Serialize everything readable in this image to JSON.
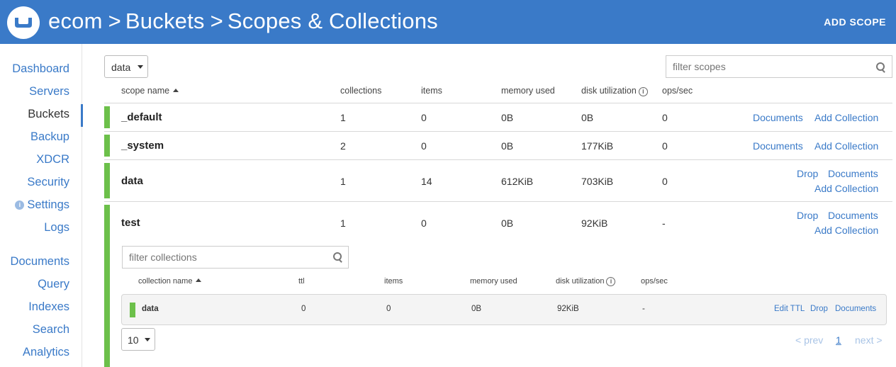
{
  "header": {
    "breadcrumb": [
      "ecom",
      "Buckets",
      "Scopes & Collections"
    ],
    "separator": ">",
    "add_scope_label": "ADD SCOPE"
  },
  "sidebar": {
    "items": [
      {
        "label": "Dashboard"
      },
      {
        "label": "Servers"
      },
      {
        "label": "Buckets",
        "active": true
      },
      {
        "label": "Backup"
      },
      {
        "label": "XDCR"
      },
      {
        "label": "Security"
      },
      {
        "label": "Settings",
        "badge": "i"
      },
      {
        "label": "Logs"
      },
      {
        "label": "Documents"
      },
      {
        "label": "Query"
      },
      {
        "label": "Indexes"
      },
      {
        "label": "Search"
      },
      {
        "label": "Analytics"
      }
    ]
  },
  "bucket_select": {
    "value": "data"
  },
  "filter_scopes": {
    "placeholder": "filter scopes"
  },
  "scope_columns": {
    "name": "scope name",
    "collections": "collections",
    "items": "items",
    "memory_used": "memory used",
    "disk_utilization": "disk utilization",
    "ops_sec": "ops/sec",
    "info": "i"
  },
  "scopes": [
    {
      "name": "_default",
      "collections": "1",
      "items": "0",
      "memory_used": "0B",
      "disk_utilization": "0B",
      "ops_sec": "0",
      "documents": "Documents",
      "add_collection": "Add Collection"
    },
    {
      "name": "_system",
      "collections": "2",
      "items": "0",
      "memory_used": "0B",
      "disk_utilization": "177KiB",
      "ops_sec": "0",
      "documents": "Documents",
      "add_collection": "Add Collection"
    },
    {
      "name": "data",
      "collections": "1",
      "items": "14",
      "memory_used": "612KiB",
      "disk_utilization": "703KiB",
      "ops_sec": "0",
      "drop": "Drop",
      "documents": "Documents",
      "add_collection": "Add Collection"
    },
    {
      "name": "test",
      "collections": "1",
      "items": "0",
      "memory_used": "0B",
      "disk_utilization": "92KiB",
      "ops_sec": "-",
      "drop": "Drop",
      "documents": "Documents",
      "add_collection": "Add Collection"
    }
  ],
  "filter_collections": {
    "placeholder": "filter collections"
  },
  "collection_columns": {
    "name": "collection name",
    "ttl": "ttl",
    "items": "items",
    "memory_used": "memory used",
    "disk_utilization": "disk utilization",
    "ops_sec": "ops/sec",
    "info": "i"
  },
  "collections": [
    {
      "name": "data",
      "ttl": "0",
      "items": "0",
      "memory_used": "0B",
      "disk_utilization": "92KiB",
      "ops_sec": "-",
      "edit_ttl": "Edit TTL",
      "drop": "Drop",
      "documents": "Documents"
    }
  ],
  "pagination": {
    "page_size": "10",
    "prev": "< prev",
    "current": "1",
    "next": "next >"
  },
  "colors": {
    "brand": "#3a7ac8",
    "status_green": "#6cc04a"
  }
}
